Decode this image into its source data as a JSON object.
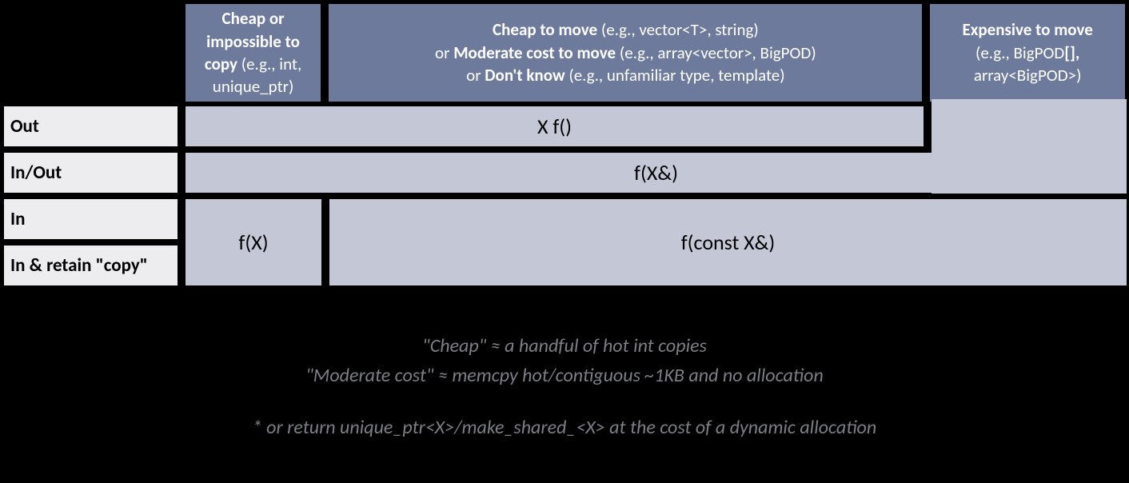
{
  "headers": {
    "col1": {
      "l1": "Cheap or",
      "l2": "impossible to",
      "l3a": "copy",
      "l3b": " (e.g., int,",
      "l4": "unique_ptr)"
    },
    "col2": {
      "l1a": "Cheap to move",
      "l1b": " (e.g., vector<T>, string)",
      "l2a": "or ",
      "l2b": "Moderate cost to move",
      "l2c": " (e.g., array<vector>, BigPOD)",
      "l3a": "or ",
      "l3b": "Don't know",
      "l3c": " (e.g., unfamiliar type, template)"
    },
    "col3": {
      "l1": "Expensive to move",
      "l2": "(e.g., BigPOD",
      "l2b": "[],",
      "l3": "array<BigPOD>)"
    }
  },
  "rows": {
    "out": "Out",
    "inout": "In/Out",
    "in": "In",
    "in_retain": "In & retain \"copy\""
  },
  "cells": {
    "out": "X f()",
    "inout": "f(X&)",
    "in_col1": "f(X)",
    "in_col23": "f(const X&)"
  },
  "footer": {
    "l1": "\"Cheap\"  ≈  a handful of hot int copies",
    "l2": "\"Moderate cost\"  ≈  memcpy hot/contiguous ~1KB and no allocation",
    "l3": "* or return unique_ptr<X>/make_shared_<X> at the cost of a dynamic allocation"
  }
}
